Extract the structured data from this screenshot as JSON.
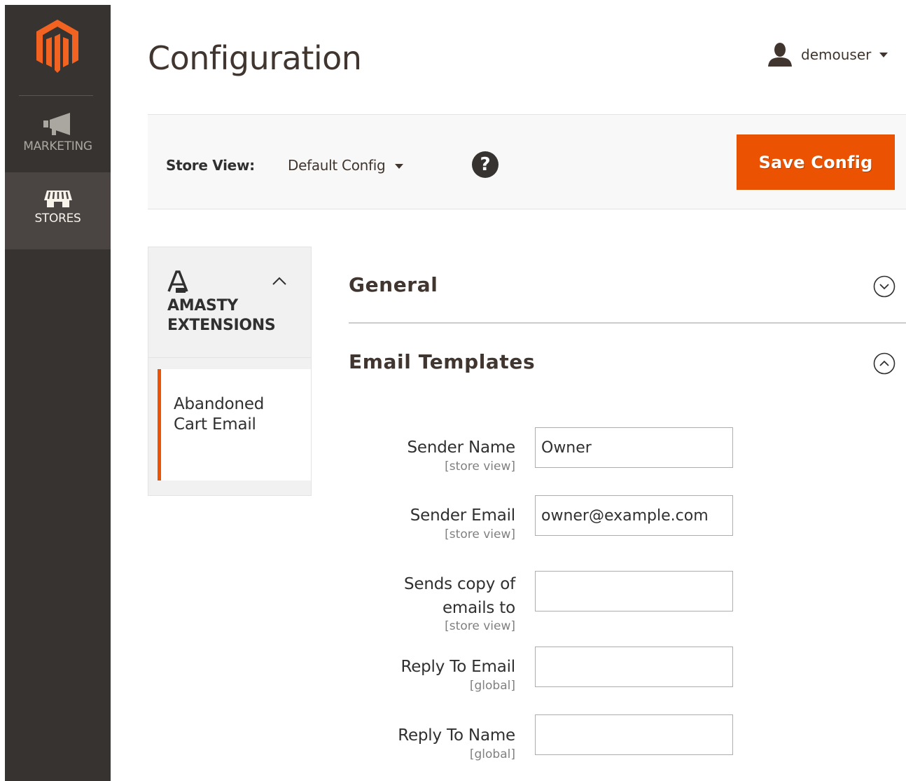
{
  "nav": {
    "items": [
      {
        "label": "MARKETING",
        "icon": "megaphone-icon"
      },
      {
        "label": "STORES",
        "icon": "store-icon"
      }
    ],
    "logo": "magento-logo",
    "active_color": "#eb5202"
  },
  "header": {
    "title": "Configuration",
    "user": "demouser"
  },
  "toolbar": {
    "store_label": "Store View:",
    "store_value": "Default Config",
    "save_label": "Save Config",
    "help_glyph": "?"
  },
  "tabs": {
    "group_title": "AMASTY\nEXTENSIONS",
    "items": [
      {
        "label": "Abandoned Cart Email",
        "active": true
      }
    ]
  },
  "sections": {
    "general": {
      "title": "General",
      "expanded": false
    },
    "email_templates": {
      "title": "Email Templates",
      "expanded": true
    }
  },
  "form": {
    "fields": [
      {
        "label": "Sender Name",
        "scope": "[store view]",
        "value": "Owner"
      },
      {
        "label": "Sender Email",
        "scope": "[store view]",
        "value": "owner@example.com"
      },
      {
        "label_line1": "Sends copy of",
        "label_line2": "emails to",
        "scope": "[store view]",
        "value": ""
      },
      {
        "label": "Reply To Email",
        "scope": "[global]",
        "value": ""
      },
      {
        "label": "Reply To Name",
        "scope": "[global]",
        "value": ""
      }
    ]
  }
}
